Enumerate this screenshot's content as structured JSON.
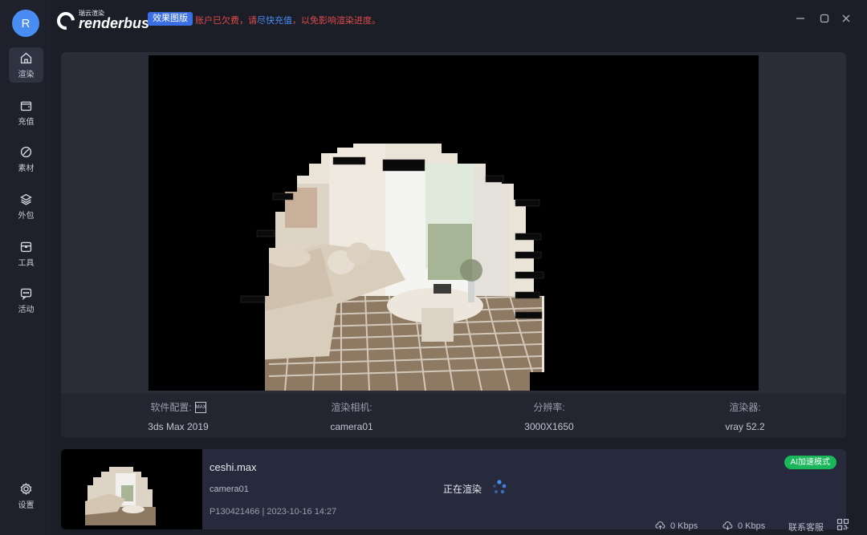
{
  "user": {
    "avatar_letter": "R"
  },
  "sidebar": {
    "items": [
      {
        "label": "渲染",
        "icon": "home-icon"
      },
      {
        "label": "充值",
        "icon": "wallet-icon"
      },
      {
        "label": "素材",
        "icon": "material-icon"
      },
      {
        "label": "外包",
        "icon": "layers-icon"
      },
      {
        "label": "工具",
        "icon": "toolbox-icon"
      },
      {
        "label": "活动",
        "icon": "chat-icon"
      }
    ],
    "settings_label": "设置"
  },
  "header": {
    "logo_cn": "瑞云渲染",
    "logo_en": "renderbus",
    "effect_badge": "效果图版",
    "notice_prefix": "账户已欠费，请",
    "notice_link": "尽快充值",
    "notice_suffix": "，以免影响渲染进度。"
  },
  "info": {
    "software_label": "软件配置:",
    "software_value": "3ds Max 2019",
    "camera_label": "渲染相机:",
    "camera_value": "camera01",
    "resolution_label": "分辨率:",
    "resolution_value": "3000X1650",
    "renderer_label": "渲染器:",
    "renderer_value": "vray 52.2"
  },
  "job": {
    "file_name": "ceshi.max",
    "camera": "camera01",
    "meta": "P130421466 | 2023-10-16 14:27",
    "status": "正在渲染",
    "ai_badge": "AI加速模式"
  },
  "footer": {
    "upload_speed": "0 Kbps",
    "download_speed": "0 Kbps",
    "support": "联系客服"
  },
  "colors": {
    "accent": "#4a8df2",
    "warning": "#e04b4b",
    "success": "#19b65a"
  }
}
